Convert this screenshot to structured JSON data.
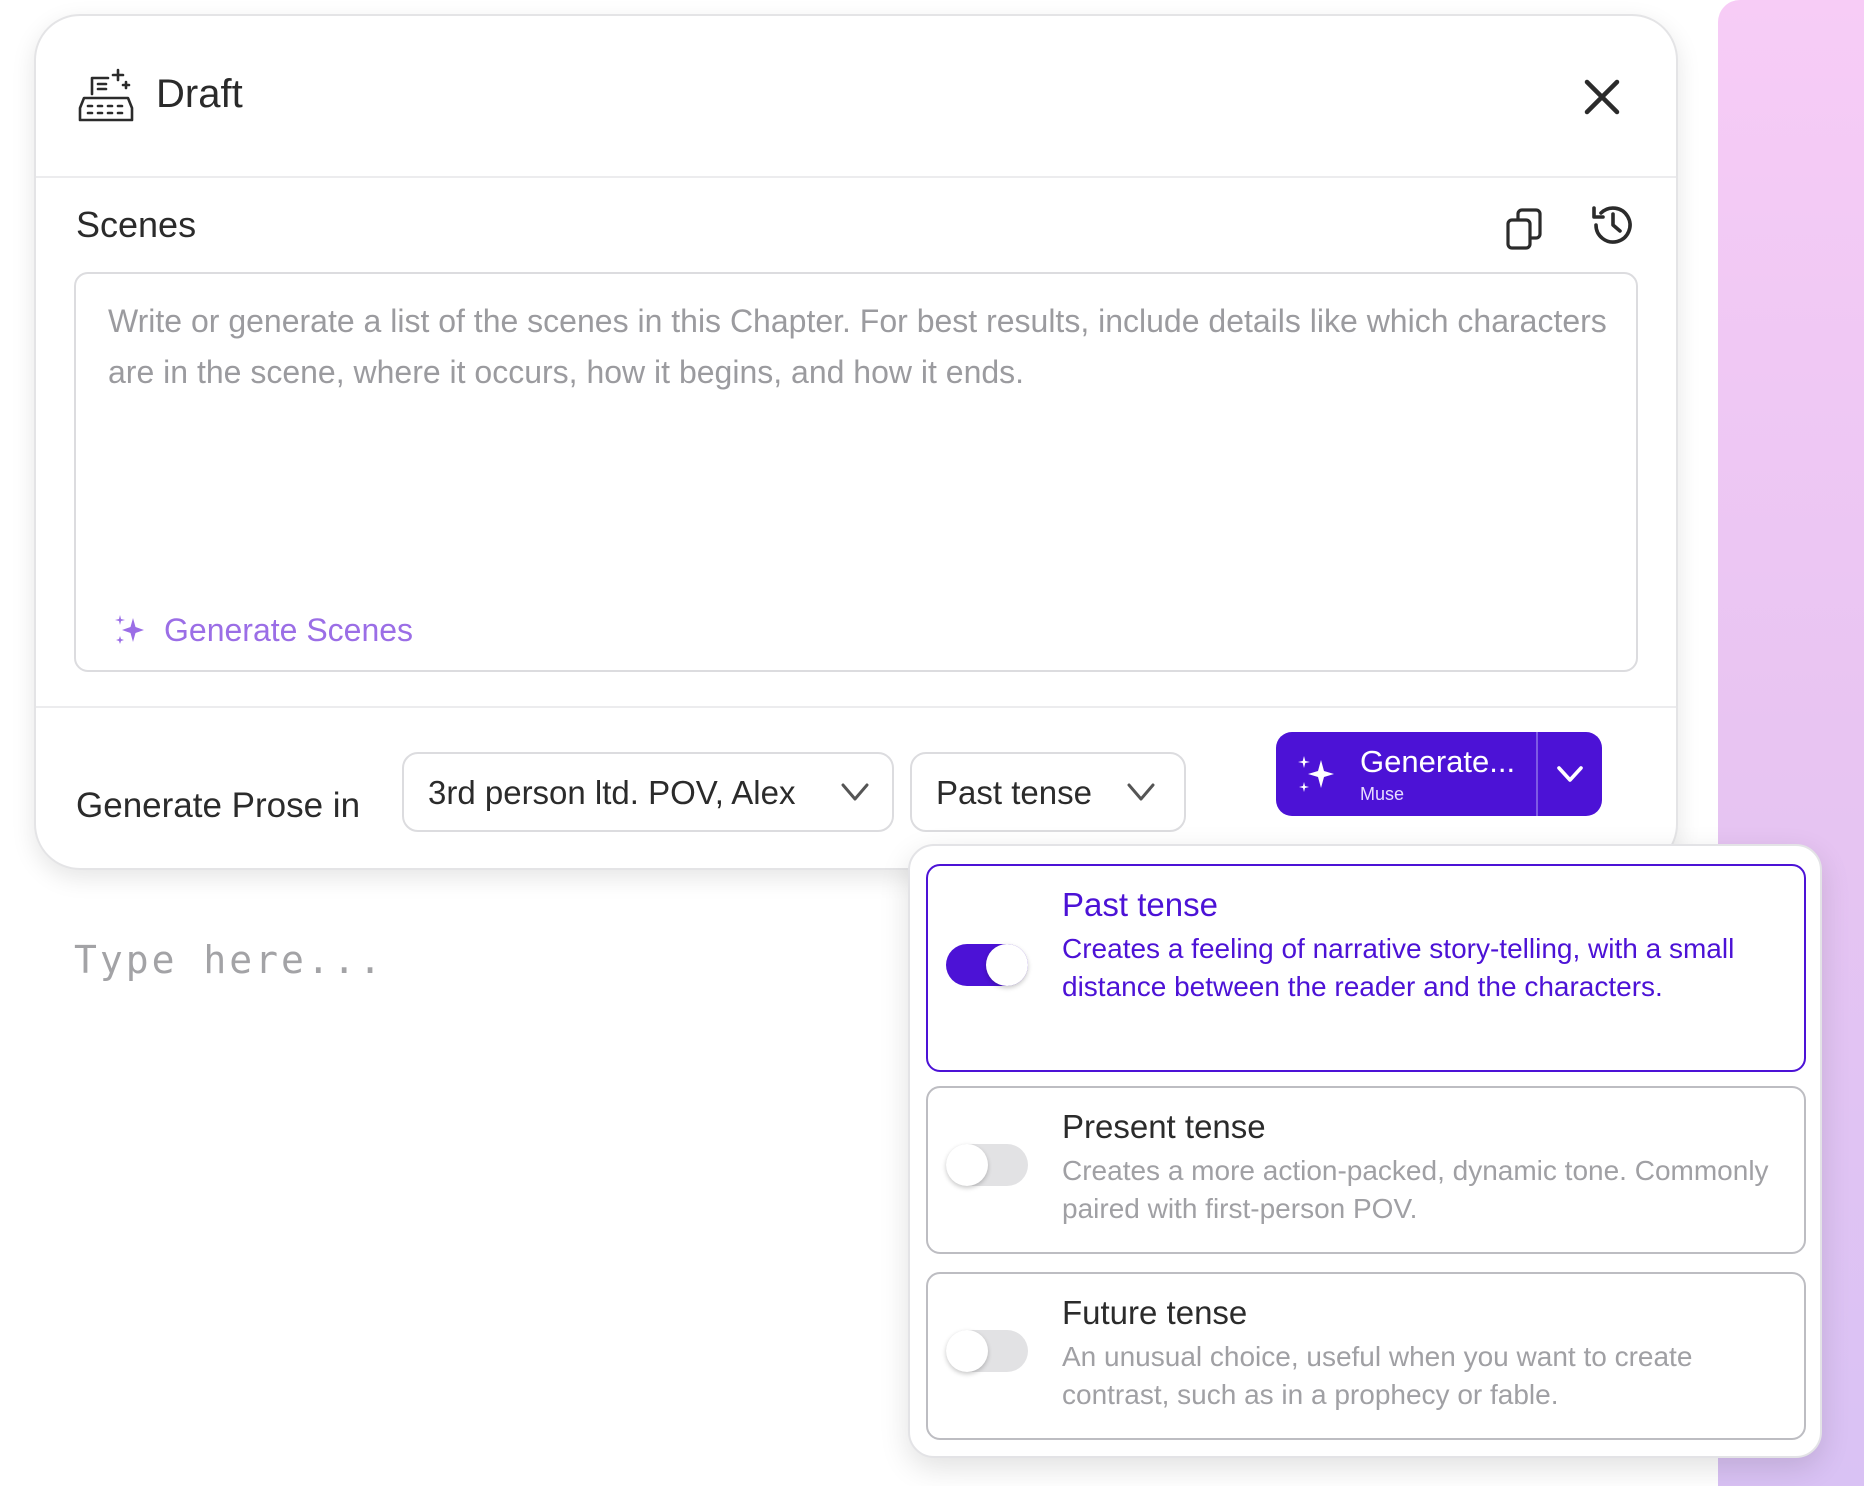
{
  "colors": {
    "accent": "#4c12d6",
    "accent_light": "#9b6ee6",
    "muted_text": "#9b9b9f",
    "side_gradient_top": "#f7ccf6",
    "side_gradient_bottom": "#d9c2f4"
  },
  "header": {
    "title": "Draft",
    "icon": "typewriter-sparkle-icon",
    "close_icon": "close-icon"
  },
  "scenes": {
    "label": "Scenes",
    "copy_icon": "copy-icon",
    "history_icon": "history-icon",
    "placeholder": "Write or generate a list of the scenes in this Chapter. For best results, include details like which characters are in the scene, where it occurs, how it begins, and how it ends.",
    "generate_label": "Generate Scenes"
  },
  "prose": {
    "label": "Generate Prose in",
    "pov_value": "3rd person ltd. POV, Alex",
    "tense_value": "Past tense",
    "generate_label": "Generate...",
    "generate_sublabel": "Muse"
  },
  "editor": {
    "placeholder": "Type here..."
  },
  "tense_dropdown": {
    "options": [
      {
        "title": "Past tense",
        "description": "Creates a feeling of narrative story-telling, with a small distance between the reader and the characters.",
        "selected": true
      },
      {
        "title": "Present tense",
        "description": "Creates a more action-packed, dynamic tone. Commonly paired with first-person POV.",
        "selected": false
      },
      {
        "title": "Future tense",
        "description": "An unusual choice, useful when you want to create contrast, such as in a prophecy or fable.",
        "selected": false
      }
    ]
  }
}
